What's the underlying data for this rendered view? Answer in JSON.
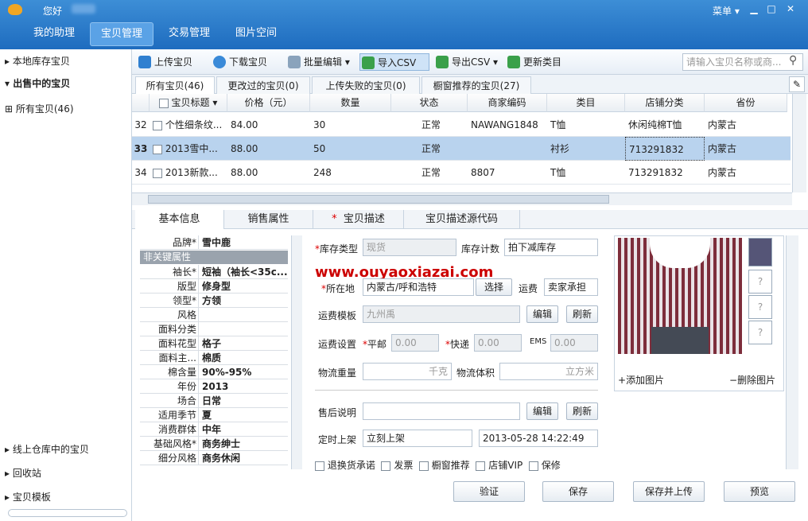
{
  "header": {
    "hello": "您好",
    "menu": "菜单",
    "tabs": [
      "我的助理",
      "宝贝管理",
      "交易管理",
      "图片空间"
    ]
  },
  "sidebar": {
    "items": [
      "本地库存宝贝",
      "出售中的宝贝",
      "所有宝贝(46)",
      "线上仓库中的宝贝",
      "回收站",
      "宝贝模板"
    ]
  },
  "toolbar": {
    "buttons": [
      "上传宝贝",
      "下载宝贝",
      "批量编辑",
      "导入CSV",
      "导出CSV",
      "更新类目"
    ],
    "search_placeholder": "请输入宝贝名称或商..."
  },
  "subtabs": [
    "所有宝贝(46)",
    "更改过的宝贝(0)",
    "上传失败的宝贝(0)",
    "橱窗推荐的宝贝(27)"
  ],
  "grid": {
    "columns": [
      "宝贝标题",
      "价格（元）",
      "数量",
      "状态",
      "商家编码",
      "类目",
      "店铺分类",
      "省份"
    ],
    "rows": [
      {
        "num": "32",
        "title": "个性细条纹...",
        "price": "84.00",
        "qty": "30",
        "status": "正常",
        "code": "NAWANG1848",
        "cat": "T恤",
        "shop": "休闲纯棉T恤",
        "prov": "内蒙古"
      },
      {
        "num": "33",
        "title": "2013雪中...",
        "price": "88.00",
        "qty": "50",
        "status": "正常",
        "code": "",
        "cat": "衬衫",
        "shop": "713291832",
        "prov": "内蒙古"
      },
      {
        "num": "34",
        "title": "2013新款...",
        "price": "88.00",
        "qty": "248",
        "status": "正常",
        "code": "8807",
        "cat": "T恤",
        "shop": "713291832",
        "prov": "内蒙古"
      }
    ]
  },
  "detail_tabs": [
    "基本信息",
    "销售属性",
    "宝贝描述",
    "宝贝描述源代码"
  ],
  "attrs": {
    "brand_k": "品牌*",
    "brand_v": "雪中鹿",
    "section": "非关键属性",
    "rows": [
      [
        "袖长*",
        "短袖（袖长<35c..."
      ],
      [
        "版型",
        "修身型"
      ],
      [
        "领型*",
        "方领"
      ],
      [
        "风格",
        ""
      ],
      [
        "面料分类",
        ""
      ],
      [
        "面料花型",
        "格子"
      ],
      [
        "面料主...",
        "棉质"
      ],
      [
        "棉含量",
        "90%-95%"
      ],
      [
        "年份",
        "2013"
      ],
      [
        "场合",
        "日常"
      ],
      [
        "适用季节",
        "夏"
      ],
      [
        "消费群体",
        "中年"
      ],
      [
        "基础风格*",
        "商务绅士"
      ],
      [
        "细分风格",
        "商务休闲"
      ]
    ]
  },
  "form": {
    "stock_type_label": "库存类型",
    "stock_type": "现货",
    "stock_count_label": "库存计数",
    "stock_count": "拍下减库存",
    "location_label": "所在地",
    "location": "内蒙古/呼和浩特",
    "choose": "选择",
    "shipping_label": "运费",
    "shipping": "卖家承担",
    "tpl_label": "运费模板",
    "tpl": "九州禹",
    "edit": "编辑",
    "refresh": "刷新",
    "setting_label": "运费设置",
    "post": "平邮",
    "post_val": "0.00",
    "express": "快递",
    "express_val": "0.00",
    "ems": "EMS",
    "ems_val": "0.00",
    "weight_label": "物流重量",
    "weight_unit": "千克",
    "volume_label": "物流体积",
    "volume_unit": "立方米",
    "after_label": "售后说明",
    "on_label": "定时上架",
    "on_val": "立刻上架",
    "datetime": "2013-05-28 14:22:49",
    "checks": [
      "退换货承诺",
      "发票",
      "橱窗推荐",
      "店铺VIP",
      "保修"
    ],
    "watermark": "www.ouyaoxiazai.com"
  },
  "images": {
    "add": "添加图片",
    "delete": "删除图片",
    "placeholder": "?"
  },
  "actions": [
    "验证",
    "保存",
    "保存并上传",
    "预览"
  ]
}
